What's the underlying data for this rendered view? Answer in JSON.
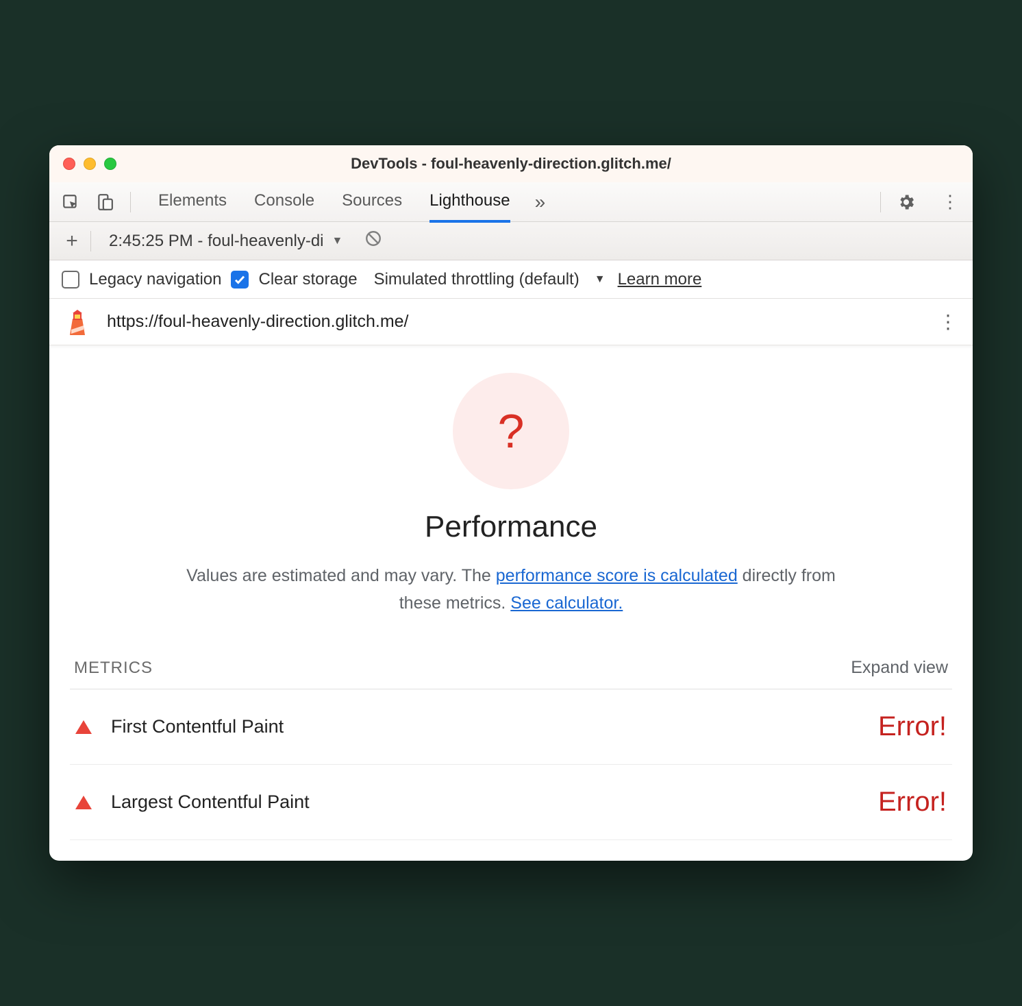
{
  "title": "DevTools - foul-heavenly-direction.glitch.me/",
  "tabs": {
    "items": [
      "Elements",
      "Console",
      "Sources",
      "Lighthouse"
    ],
    "active": "Lighthouse"
  },
  "toolbar": {
    "report_select": "2:45:25 PM - foul-heavenly-di"
  },
  "settings": {
    "legacy_label": "Legacy navigation",
    "clear_label": "Clear storage",
    "throttle_label": "Simulated throttling (default)",
    "learn_more": "Learn more"
  },
  "url": "https://foul-heavenly-direction.glitch.me/",
  "gauge": {
    "mark": "?"
  },
  "perf": {
    "title": "Performance",
    "desc_pre": "Values are estimated and may vary. The ",
    "link1": "performance score is calculated",
    "desc_mid": " directly from these metrics. ",
    "link2": "See calculator."
  },
  "metrics": {
    "heading": "METRICS",
    "expand": "Expand view",
    "rows": [
      {
        "name": "First Contentful Paint",
        "value": "Error!"
      },
      {
        "name": "Largest Contentful Paint",
        "value": "Error!"
      }
    ]
  }
}
